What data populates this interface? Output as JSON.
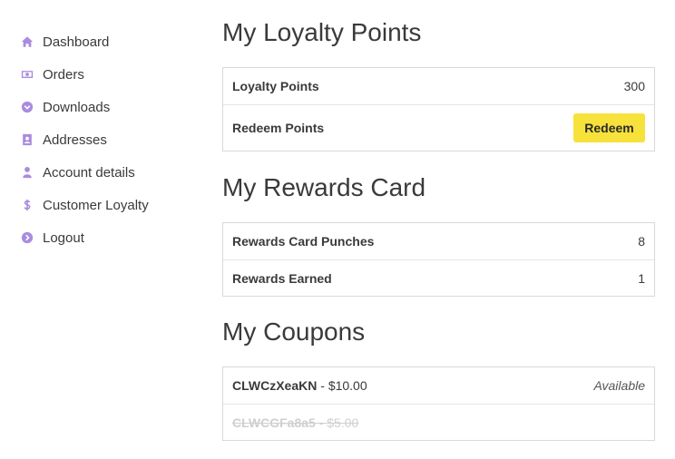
{
  "sidebar": {
    "items": [
      {
        "label": "Dashboard",
        "icon": "home-icon"
      },
      {
        "label": "Orders",
        "icon": "money-icon"
      },
      {
        "label": "Downloads",
        "icon": "download-icon"
      },
      {
        "label": "Addresses",
        "icon": "address-card-icon"
      },
      {
        "label": "Account details",
        "icon": "user-icon"
      },
      {
        "label": "Customer Loyalty",
        "icon": "dollar-icon"
      },
      {
        "label": "Logout",
        "icon": "logout-icon"
      }
    ]
  },
  "loyalty": {
    "title": "My Loyalty Points",
    "points_label": "Loyalty Points",
    "points_value": "300",
    "redeem_label": "Redeem Points",
    "redeem_button": "Redeem"
  },
  "rewards": {
    "title": "My Rewards Card",
    "punches_label": "Rewards Card Punches",
    "punches_value": "8",
    "earned_label": "Rewards Earned",
    "earned_value": "1"
  },
  "coupons": {
    "title": "My Coupons",
    "items": [
      {
        "code": "CLWCzXeaKN",
        "amount": "$10.00",
        "status": "Available",
        "used": false
      },
      {
        "code": "CLWCGFa8a5",
        "amount": "$5.00",
        "status": "",
        "used": true
      }
    ]
  },
  "colors": {
    "accent": "#a98be0",
    "button": "#f7e13b",
    "border": "#d9d9d9"
  }
}
